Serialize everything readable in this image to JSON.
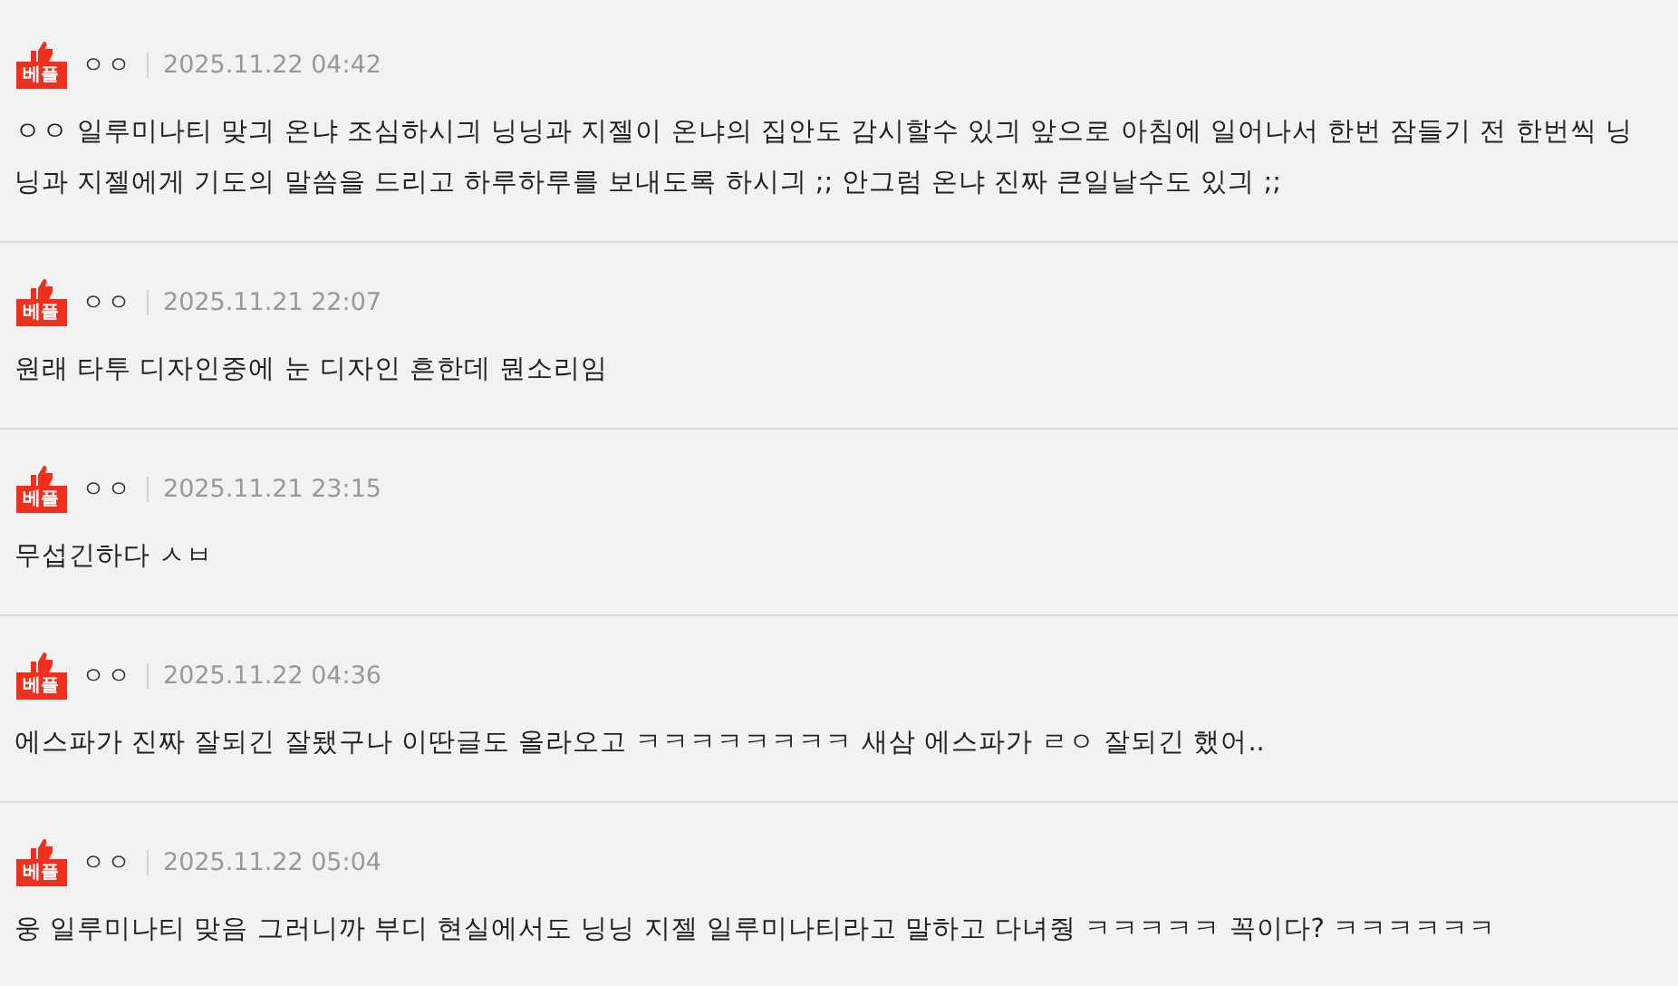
{
  "comments": [
    {
      "badge": "베플",
      "author": "ㅇㅇ",
      "date": "2025.11.22 04:42",
      "text": "ㅇㅇ 일루미나티 맞긔 온냐 조심하시긔 닝닝과 지젤이 온냐의 집안도 감시할수 있긔 앞으로 아침에 일어나서 한번 잠들기 전 한번씩 닝닝과 지젤에게 기도의 말씀을 드리고 하루하루를 보내도록 하시긔 ;; 안그럼 온냐 진짜 큰일날수도 있긔 ;;"
    },
    {
      "badge": "베플",
      "author": "ㅇㅇ",
      "date": "2025.11.21 22:07",
      "text": "원래 타투 디자인중에 눈 디자인 흔한데 뭔소리임"
    },
    {
      "badge": "베플",
      "author": "ㅇㅇ",
      "date": "2025.11.21 23:15",
      "text": "무섭긴하다 ㅅㅂ"
    },
    {
      "badge": "베플",
      "author": "ㅇㅇ",
      "date": "2025.11.22 04:36",
      "text": "에스파가 진짜 잘되긴 잘됐구나 이딴글도 올라오고 ㅋㅋㅋㅋㅋㅋㅋㅋ 새삼 에스파가 ㄹㅇ 잘되긴 했어.."
    },
    {
      "badge": "베플",
      "author": "ㅇㅇ",
      "date": "2025.11.22 05:04",
      "text": "웅 일루미나티 맞음 그러니까 부디 현실에서도 닝닝 지젤 일루미나티라고 말하고 다녀줭 ㅋㅋㅋㅋㅋ 꼭이다? ㅋㅋㅋㅋㅋㅋ"
    }
  ]
}
